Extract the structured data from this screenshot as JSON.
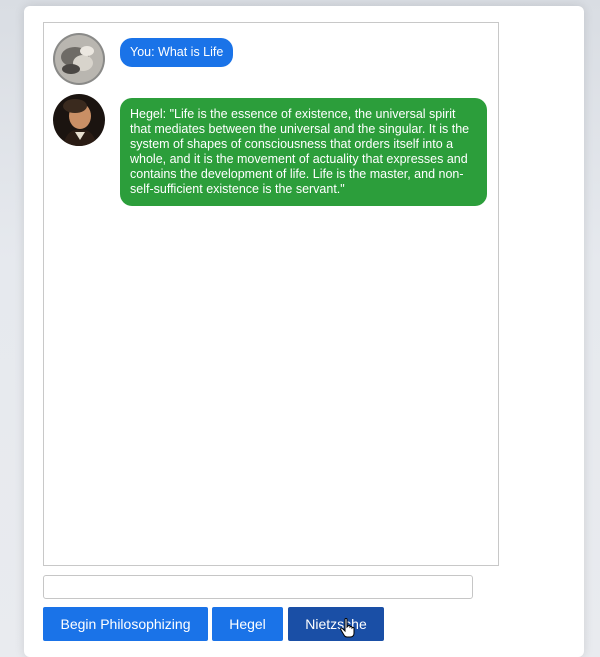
{
  "chat": {
    "messages": [
      {
        "sender": "user",
        "text": "You: What is Life",
        "avatar_icon": "user-avatar-icon"
      },
      {
        "sender": "Hegel",
        "text": "Hegel: \"Life is the essence of existence, the universal spirit that mediates between the universal and the singular. It is the system of shapes of consciousness that orders itself into a whole, and it is the movement of actuality that expresses and contains the development of life. Life is the master, and non-self-sufficient existence is the servant.\"",
        "avatar_icon": "hegel-portrait-icon"
      }
    ]
  },
  "input": {
    "placeholder": "",
    "value": ""
  },
  "buttons": {
    "begin": "Begin Philosophizing",
    "hegel": "Hegel",
    "nietzsche": "Nietzsche"
  },
  "colors": {
    "user_bubble": "#1a73e8",
    "bot_bubble": "#2c9e3b",
    "button": "#1a73e8",
    "button_active": "#1a4fa6"
  }
}
